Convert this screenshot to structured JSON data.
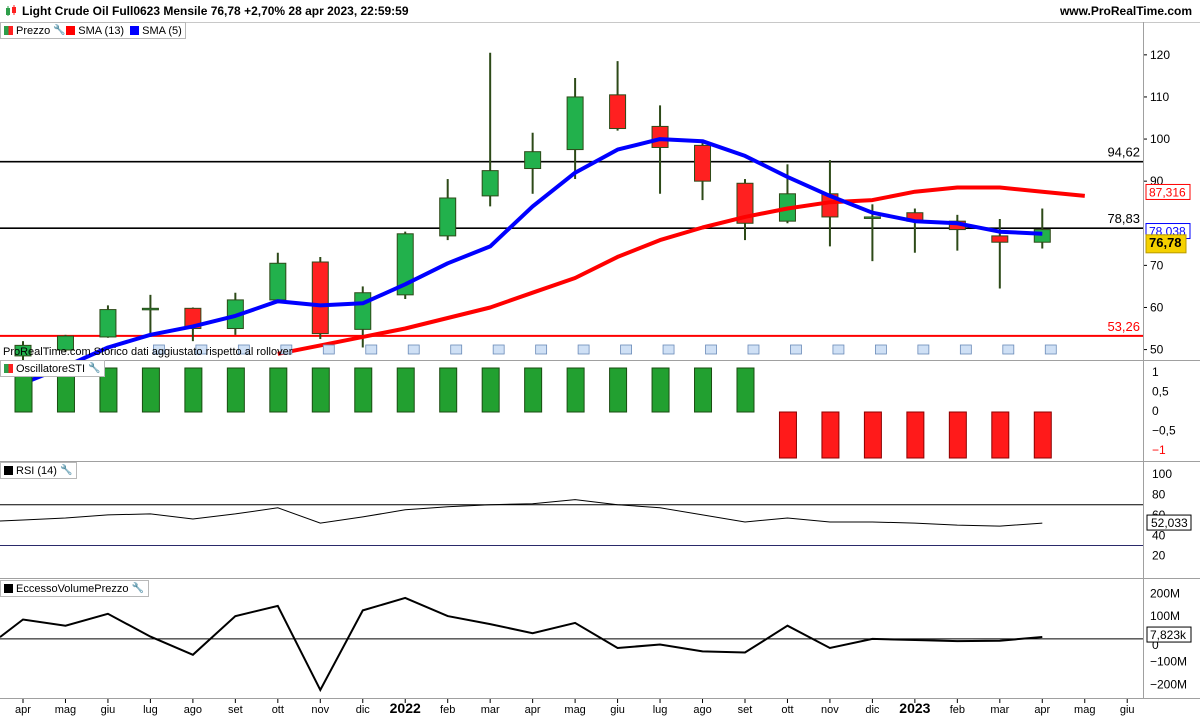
{
  "header": {
    "title": "Light Crude Oil Full0623 Mensile 76,78 +2,70% 28 apr 2023, 22:59:59",
    "site": "www.ProRealTime.com"
  },
  "note": "ProRealTime.com  Storico dati aggiustato rispetto al rollover",
  "legends": {
    "price": [
      {
        "label": "Prezzo",
        "color": "#2e9e4a"
      },
      {
        "label": "SMA (13)",
        "color": "#ff0000"
      },
      {
        "label": "SMA (5)",
        "color": "#0000ff"
      }
    ],
    "sti": {
      "label": "OscillatoreSTI"
    },
    "rsi": {
      "label": "RSI (14)"
    },
    "vol": {
      "label": "EccessoVolumePrezzo"
    }
  },
  "colors": {
    "up": "#22b14c",
    "down": "#ff2020",
    "sma13": "#ff0000",
    "sma5": "#0000ff"
  },
  "chart_data": [
    {
      "type": "candlestick",
      "title": "Light Crude Oil Full0623 Mensile",
      "x_labels": [
        "apr",
        "mag",
        "giu",
        "lug",
        "ago",
        "set",
        "ott",
        "nov",
        "dic",
        "2022",
        "feb",
        "mar",
        "apr",
        "mag",
        "giu",
        "lug",
        "ago",
        "set",
        "ott",
        "nov",
        "dic",
        "2023",
        "feb",
        "mar",
        "apr",
        "mag",
        "giu"
      ],
      "candles": [
        {
          "o": 48.5,
          "h": 52.0,
          "l": 46.0,
          "c": 51.0
        },
        {
          "o": 49.9,
          "h": 53.5,
          "l": 49.5,
          "c": 53.2
        },
        {
          "o": 53.0,
          "h": 60.5,
          "l": 52.8,
          "c": 59.5
        },
        {
          "o": 59.5,
          "h": 63.0,
          "l": 53.0,
          "c": 59.8
        },
        {
          "o": 59.8,
          "h": 60.0,
          "l": 52.0,
          "c": 55.0
        },
        {
          "o": 55.0,
          "h": 63.5,
          "l": 53.5,
          "c": 61.8
        },
        {
          "o": 61.8,
          "h": 73.0,
          "l": 61.0,
          "c": 70.5
        },
        {
          "o": 70.8,
          "h": 72.0,
          "l": 52.5,
          "c": 53.8
        },
        {
          "o": 54.8,
          "h": 65.0,
          "l": 50.5,
          "c": 63.5
        },
        {
          "o": 63.0,
          "h": 78.0,
          "l": 62.0,
          "c": 77.5
        },
        {
          "o": 77.0,
          "h": 90.5,
          "l": 76.0,
          "c": 86.0
        },
        {
          "o": 86.5,
          "h": 120.5,
          "l": 84.0,
          "c": 92.5
        },
        {
          "o": 93.0,
          "h": 101.5,
          "l": 87.0,
          "c": 97.0
        },
        {
          "o": 97.5,
          "h": 114.5,
          "l": 90.5,
          "c": 110.0
        },
        {
          "o": 110.5,
          "h": 118.5,
          "l": 102.0,
          "c": 102.5
        },
        {
          "o": 103.0,
          "h": 108.0,
          "l": 87.0,
          "c": 98.0
        },
        {
          "o": 98.5,
          "h": 99.5,
          "l": 85.5,
          "c": 90.0
        },
        {
          "o": 89.5,
          "h": 90.5,
          "l": 76.0,
          "c": 80.0
        },
        {
          "o": 80.5,
          "h": 94.0,
          "l": 80.0,
          "c": 87.0
        },
        {
          "o": 87.0,
          "h": 95.0,
          "l": 74.5,
          "c": 81.5
        },
        {
          "o": 81.5,
          "h": 84.5,
          "l": 71.0,
          "c": 81.5
        },
        {
          "o": 82.5,
          "h": 83.5,
          "l": 73.0,
          "c": 80.5
        },
        {
          "o": 80.5,
          "h": 82.0,
          "l": 73.5,
          "c": 78.5
        },
        {
          "o": 77.0,
          "h": 81.0,
          "l": 64.5,
          "c": 75.5
        },
        {
          "o": 75.5,
          "h": 83.5,
          "l": 74.0,
          "c": 78.5
        }
      ],
      "sma13": {
        "start_index": 6,
        "values": [
          49.0,
          51.0,
          53.0,
          55.0,
          57.5,
          60.0,
          63.5,
          67.0,
          72.0,
          76.0,
          79.0,
          81.5,
          83.5,
          85.0,
          85.5,
          87.5,
          88.5,
          88.5,
          87.5,
          86.5
        ]
      },
      "sma5": {
        "start_index": 0,
        "values": [
          42.0,
          46.0,
          50.5,
          53.5,
          55.5,
          58.0,
          61.5,
          60.5,
          61.0,
          65.5,
          70.5,
          74.5,
          84.0,
          92.0,
          97.5,
          100.0,
          99.5,
          96.0,
          91.0,
          86.5,
          82.5,
          80.5,
          80.0,
          78.0,
          77.5
        ]
      },
      "hlines": [
        {
          "value": 94.62,
          "label": "94,62",
          "color": "#000000"
        },
        {
          "value": 78.83,
          "label": "78,83",
          "color": "#000000"
        },
        {
          "value": 53.26,
          "label": "53,26",
          "color": "#ff0000"
        }
      ],
      "y_ticks": [
        "120",
        "110",
        "100",
        "90",
        "70",
        "60",
        "50"
      ],
      "last_labels": [
        {
          "value": 87.316,
          "label": "87,316",
          "kind": "sma13"
        },
        {
          "value": 78.038,
          "label": "78,038",
          "kind": "sma5"
        },
        {
          "value": 76.78,
          "label": "76,78",
          "kind": "price"
        }
      ],
      "ylim": [
        48,
        124
      ]
    },
    {
      "type": "bar",
      "title": "OscillatoreSTI",
      "values": [
        1,
        1,
        1,
        1,
        1,
        1,
        1,
        1,
        1,
        1,
        1,
        1,
        1,
        1,
        1,
        1,
        1,
        1,
        -1,
        -1,
        -1,
        -1,
        -1,
        -1,
        -1
      ],
      "y_ticks": [
        "1",
        "0,5",
        "0",
        "−0,5",
        "−1"
      ],
      "ylim": [
        -1.2,
        1.2
      ]
    },
    {
      "type": "line",
      "title": "RSI (14)",
      "values": [
        55,
        57,
        60,
        61,
        56,
        61,
        67,
        52,
        58,
        65,
        68,
        70,
        71,
        75,
        70,
        67,
        60,
        53,
        57,
        53,
        53,
        52,
        50,
        49,
        52
      ],
      "levels": [
        70,
        30
      ],
      "y_ticks": [
        "100",
        "80",
        "60",
        "40",
        "20"
      ],
      "last_label": "52,033",
      "ylim": [
        0,
        110
      ]
    },
    {
      "type": "line",
      "title": "EccessoVolumePrezzo",
      "values": [
        7.8,
        85,
        58,
        110,
        10,
        -70,
        100,
        145,
        -225,
        125,
        180,
        100,
        65,
        25,
        70,
        -40,
        -25,
        -55,
        -60,
        58,
        -40,
        0,
        -5,
        -10,
        -8,
        8
      ],
      "x_start_index": -1,
      "y_ticks": [
        "200M",
        "100M",
        "−100M",
        "−200M",
        "0"
      ],
      "last_label": "7,823k",
      "ylim": [
        -260,
        250
      ]
    }
  ]
}
